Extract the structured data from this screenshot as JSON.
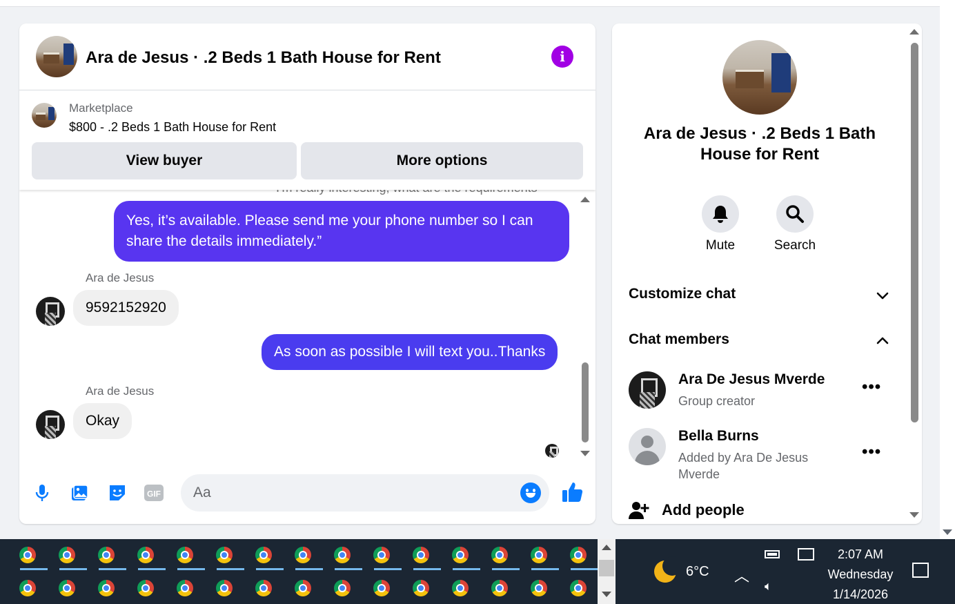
{
  "chat": {
    "title": "Ara de Jesus · .2 Beds 1 Bath House for Rent",
    "marketplace": {
      "label": "Marketplace",
      "item": "$800 - .2 Beds 1 Bath House for Rent",
      "view_buyer": "View buyer",
      "more_options": "More options"
    },
    "peek_text": "I'm really interesting, what are the requirements",
    "messages": [
      {
        "direction": "out",
        "text": "Yes, it’s available. Please send me your phone number so I can share the details immediately.”"
      },
      {
        "direction": "in",
        "sender": "Ara de Jesus",
        "text": "9592152920"
      },
      {
        "direction": "out",
        "text": "As soon as possible I will text you..Thanks"
      },
      {
        "direction": "in",
        "sender": "Ara de Jesus",
        "text": "Okay"
      }
    ],
    "composer_placeholder": "Aa",
    "accent_color": "#a100e4",
    "bubble_color": "#4f38ee"
  },
  "info": {
    "title": "Ara de Jesus · .2 Beds 1 Bath House for Rent",
    "mute_label": "Mute",
    "search_label": "Search",
    "customize_chat": "Customize chat",
    "chat_members": "Chat members",
    "members": [
      {
        "name": "Ara De Jesus Mverde",
        "subtitle": "Group creator"
      },
      {
        "name": "Bella Burns",
        "subtitle": "Added by Ara De Jesus Mverde"
      }
    ],
    "add_people": "Add people"
  },
  "taskbar": {
    "weather": "6°C",
    "time": "2:07 AM",
    "day": "Wednesday",
    "date": "1/14/2026"
  }
}
